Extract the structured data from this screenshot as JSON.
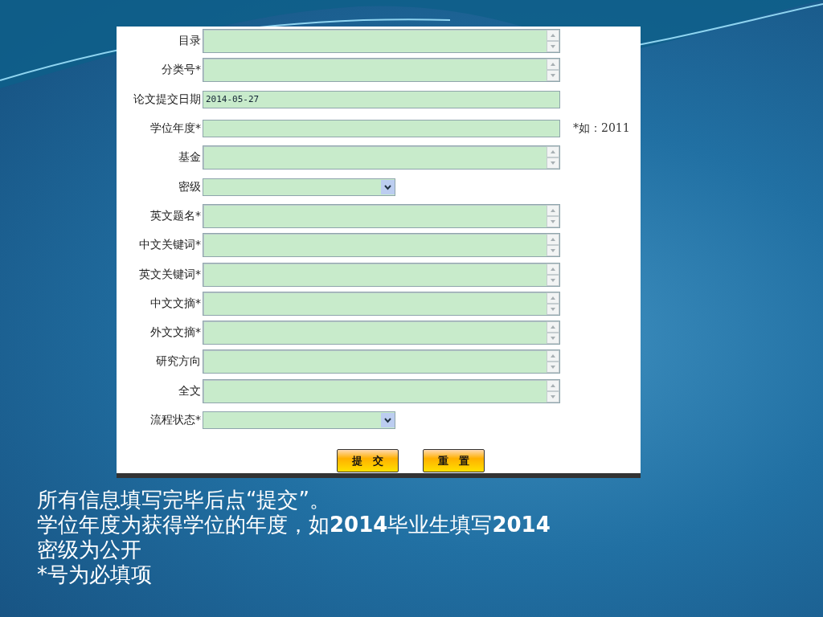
{
  "form": {
    "fields": [
      {
        "label": "目录",
        "kind": "textarea"
      },
      {
        "label": "分类号*",
        "kind": "textarea"
      },
      {
        "label": "论文提交日期",
        "kind": "text",
        "value": "2014-05-27"
      },
      {
        "label": "学位年度*",
        "kind": "text",
        "hint": "*如：2011"
      },
      {
        "label": "基金",
        "kind": "textarea"
      },
      {
        "label": "密级",
        "kind": "select"
      },
      {
        "label": "英文题名*",
        "kind": "textarea"
      },
      {
        "label": "中文关键词*",
        "kind": "textarea"
      },
      {
        "label": "英文关键词*",
        "kind": "textarea"
      },
      {
        "label": "中文文摘*",
        "kind": "textarea"
      },
      {
        "label": "外文文摘*",
        "kind": "textarea"
      },
      {
        "label": "研究方向",
        "kind": "textarea"
      },
      {
        "label": "全文",
        "kind": "textarea"
      },
      {
        "label": "流程状态*",
        "kind": "select"
      }
    ],
    "buttons": [
      "提　交",
      "重　置"
    ]
  },
  "notes": [
    "所有信息填写完毕后点“提交”。",
    "学位年度为获得学位的年度，如**2014**毕业生填写**2014**",
    "密级为公开",
    "*号为必填项"
  ]
}
